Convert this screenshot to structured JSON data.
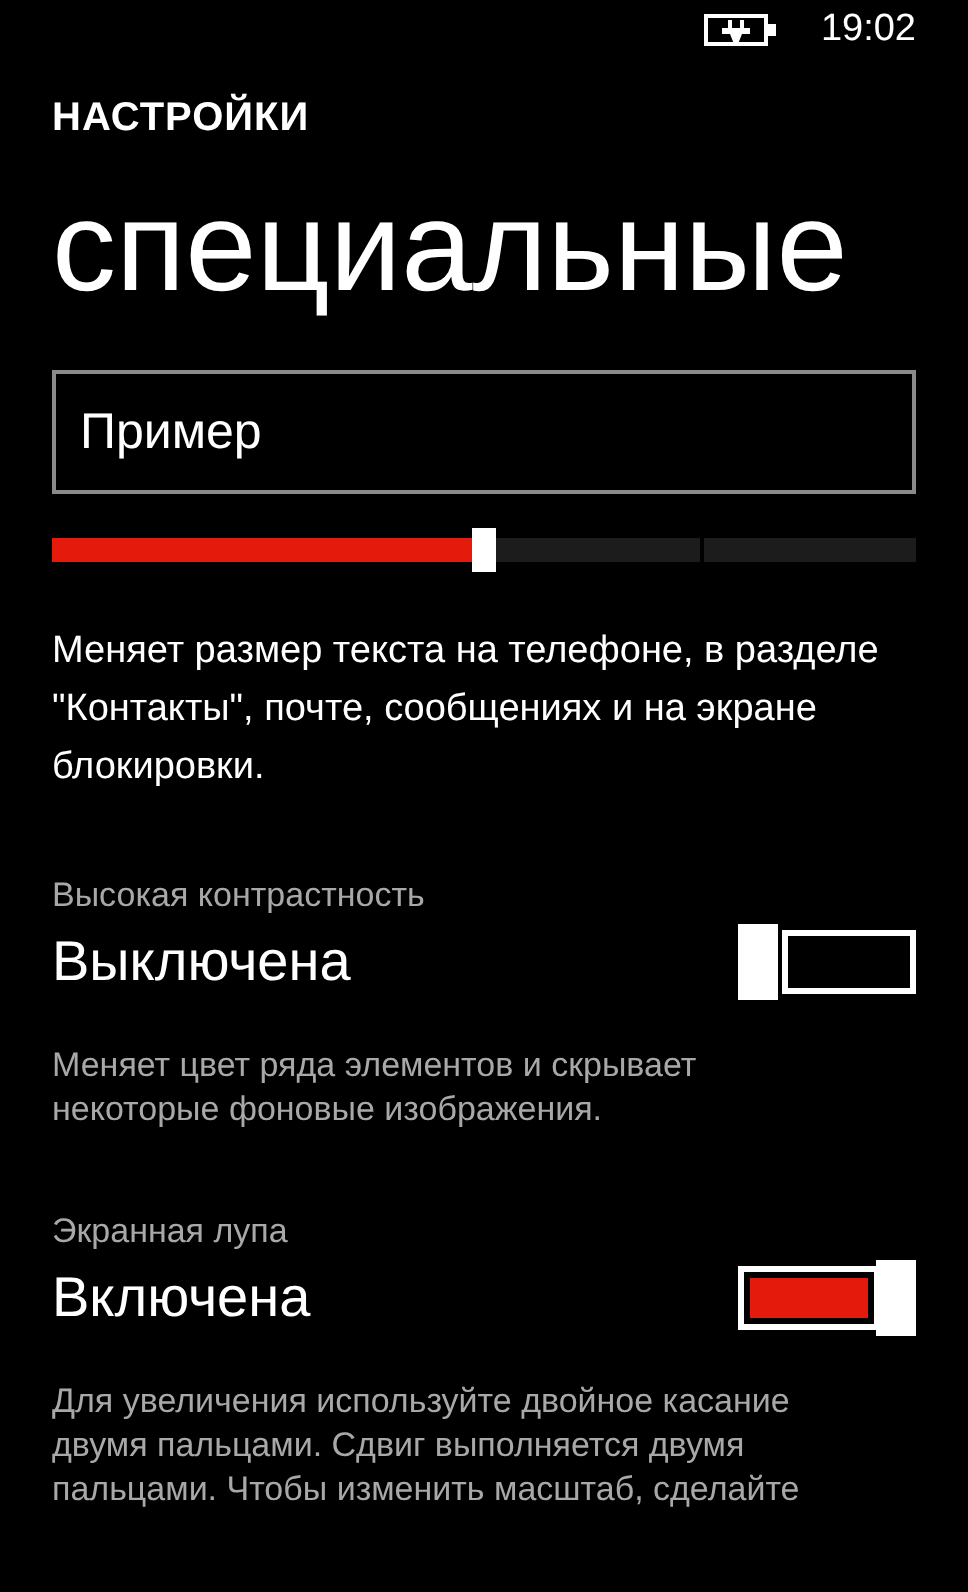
{
  "status_bar": {
    "time": "19:02"
  },
  "header": {
    "app": "НАСТРОЙКИ",
    "title": "специальные"
  },
  "text_size": {
    "sample": "Пример",
    "level": 0.5,
    "description": "Меняет размер текста на телефоне, в разделе \"Контакты\", почте, сообщениях и на экране блокировки."
  },
  "settings": [
    {
      "label": "Высокая контрастность",
      "state": "Выключена",
      "on": false,
      "description": "Меняет цвет ряда элементов и скрывает некоторые фоновые изображения."
    },
    {
      "label": "Экранная лупа",
      "state": "Включена",
      "on": true,
      "description": "Для увеличения используйте двойное касание двумя пальцами. Сдвиг выполняется двумя пальцами. Чтобы изменить масштаб, сделайте"
    }
  ]
}
